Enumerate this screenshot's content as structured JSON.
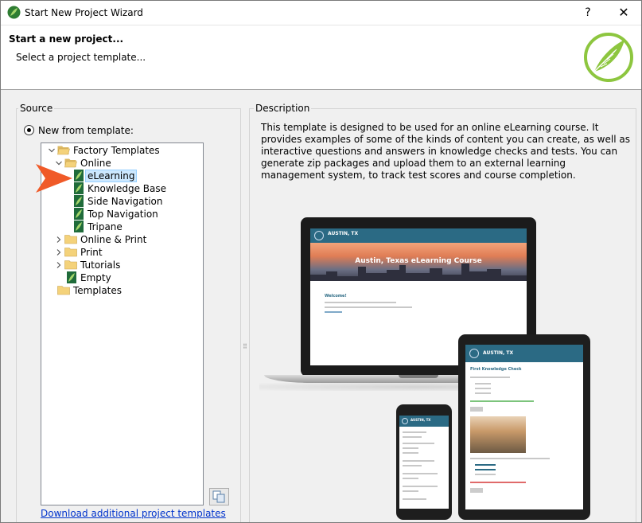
{
  "window": {
    "title": "Start New Project Wizard",
    "help_glyph": "?",
    "close_glyph": "✕"
  },
  "header": {
    "title": "Start a new project...",
    "subtitle": "Select a project template..."
  },
  "source": {
    "group_label": "Source",
    "radio_label": "New from template:",
    "tree": [
      {
        "label": "Factory Templates",
        "type": "folder",
        "expanded": true,
        "depth": 0
      },
      {
        "label": "Online",
        "type": "folder",
        "expanded": true,
        "depth": 1
      },
      {
        "label": "eLearning",
        "type": "template",
        "selected": true,
        "depth": 2
      },
      {
        "label": "Knowledge Base",
        "type": "template",
        "depth": 2
      },
      {
        "label": "Side Navigation",
        "type": "template",
        "depth": 2
      },
      {
        "label": "Top Navigation",
        "type": "template",
        "depth": 2
      },
      {
        "label": "Tripane",
        "type": "template",
        "depth": 2
      },
      {
        "label": "Online & Print",
        "type": "folder",
        "expanded": false,
        "depth": 1
      },
      {
        "label": "Print",
        "type": "folder",
        "expanded": false,
        "depth": 1
      },
      {
        "label": "Tutorials",
        "type": "folder",
        "expanded": false,
        "depth": 1
      },
      {
        "label": "Empty",
        "type": "template",
        "depth": 1
      },
      {
        "label": "Templates",
        "type": "folder",
        "expanded": false,
        "depth": 0
      }
    ],
    "download_link": "Download additional project templates"
  },
  "description": {
    "group_label": "Description",
    "text": "This template is designed to be used for an online eLearning course. It provides examples of some of the kinds of content you can create, as well as interactive questions and answers in knowledge checks and tests. You can generate zip packages and upload them to an external learning management system, to track test scores and course completion.",
    "preview": {
      "site_name": "AUSTIN, TX",
      "hero_title": "Austin, Texas eLearning Course",
      "welcome": "Welcome!",
      "tablet_heading": "First Knowledge Check"
    }
  },
  "colors": {
    "accent": "#8dc63f",
    "pointer": "#f05a28",
    "site_bar": "#2b6a84",
    "link": "#0033cc"
  }
}
